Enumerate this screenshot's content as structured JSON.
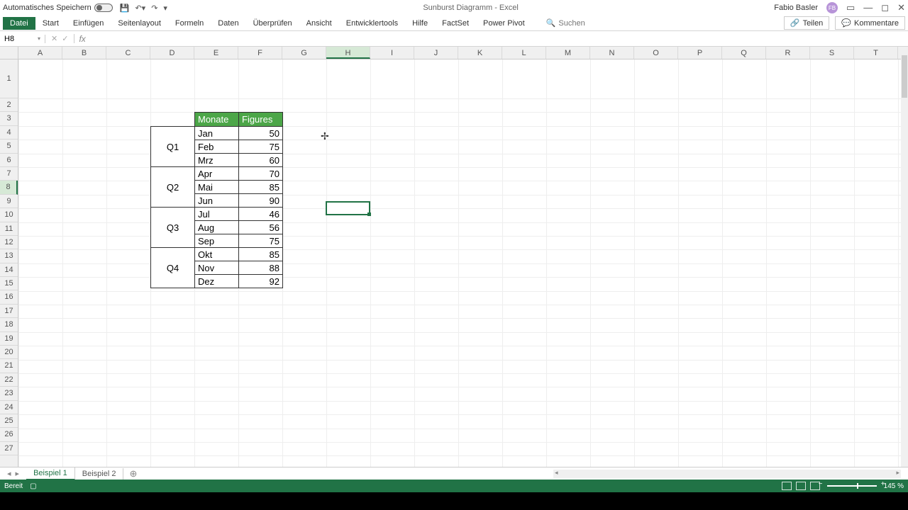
{
  "title": {
    "autosave": "Automatisches Speichern",
    "doc": "Sunburst Diagramm - Excel",
    "user": "Fabio Basler",
    "user_initials": "FB"
  },
  "ribbon": {
    "file": "Datei",
    "tabs": [
      "Start",
      "Einfügen",
      "Seitenlayout",
      "Formeln",
      "Daten",
      "Überprüfen",
      "Ansicht",
      "Entwicklertools",
      "Hilfe",
      "FactSet",
      "Power Pivot"
    ],
    "search_placeholder": "Suchen",
    "share": "Teilen",
    "comments": "Kommentare"
  },
  "name_box": "H8",
  "columns": [
    "A",
    "B",
    "C",
    "D",
    "E",
    "F",
    "G",
    "H",
    "I",
    "J",
    "K",
    "L",
    "M",
    "N",
    "O",
    "P",
    "Q",
    "R",
    "S",
    "T"
  ],
  "rows_first": "1",
  "rows_rest": [
    "2",
    "3",
    "4",
    "5",
    "6",
    "7",
    "8",
    "9",
    "10",
    "11",
    "12",
    "13",
    "14",
    "15",
    "16",
    "17",
    "18",
    "19",
    "20",
    "21",
    "22",
    "23",
    "24",
    "25",
    "26",
    "27"
  ],
  "table": {
    "h1": "Monate",
    "h2": "Figures",
    "quarters": [
      "Q1",
      "Q2",
      "Q3",
      "Q4"
    ],
    "rows": [
      {
        "m": "Jan",
        "v": "50"
      },
      {
        "m": "Feb",
        "v": "75"
      },
      {
        "m": "Mrz",
        "v": "60"
      },
      {
        "m": "Apr",
        "v": "70"
      },
      {
        "m": "Mai",
        "v": "85"
      },
      {
        "m": "Jun",
        "v": "90"
      },
      {
        "m": "Jul",
        "v": "46"
      },
      {
        "m": "Aug",
        "v": "56"
      },
      {
        "m": "Sep",
        "v": "75"
      },
      {
        "m": "Okt",
        "v": "85"
      },
      {
        "m": "Nov",
        "v": "88"
      },
      {
        "m": "Dez",
        "v": "92"
      }
    ]
  },
  "sheets": {
    "active": "Beispiel 1",
    "other": "Beispiel 2"
  },
  "status": {
    "ready": "Bereit",
    "zoom": "145 %"
  }
}
